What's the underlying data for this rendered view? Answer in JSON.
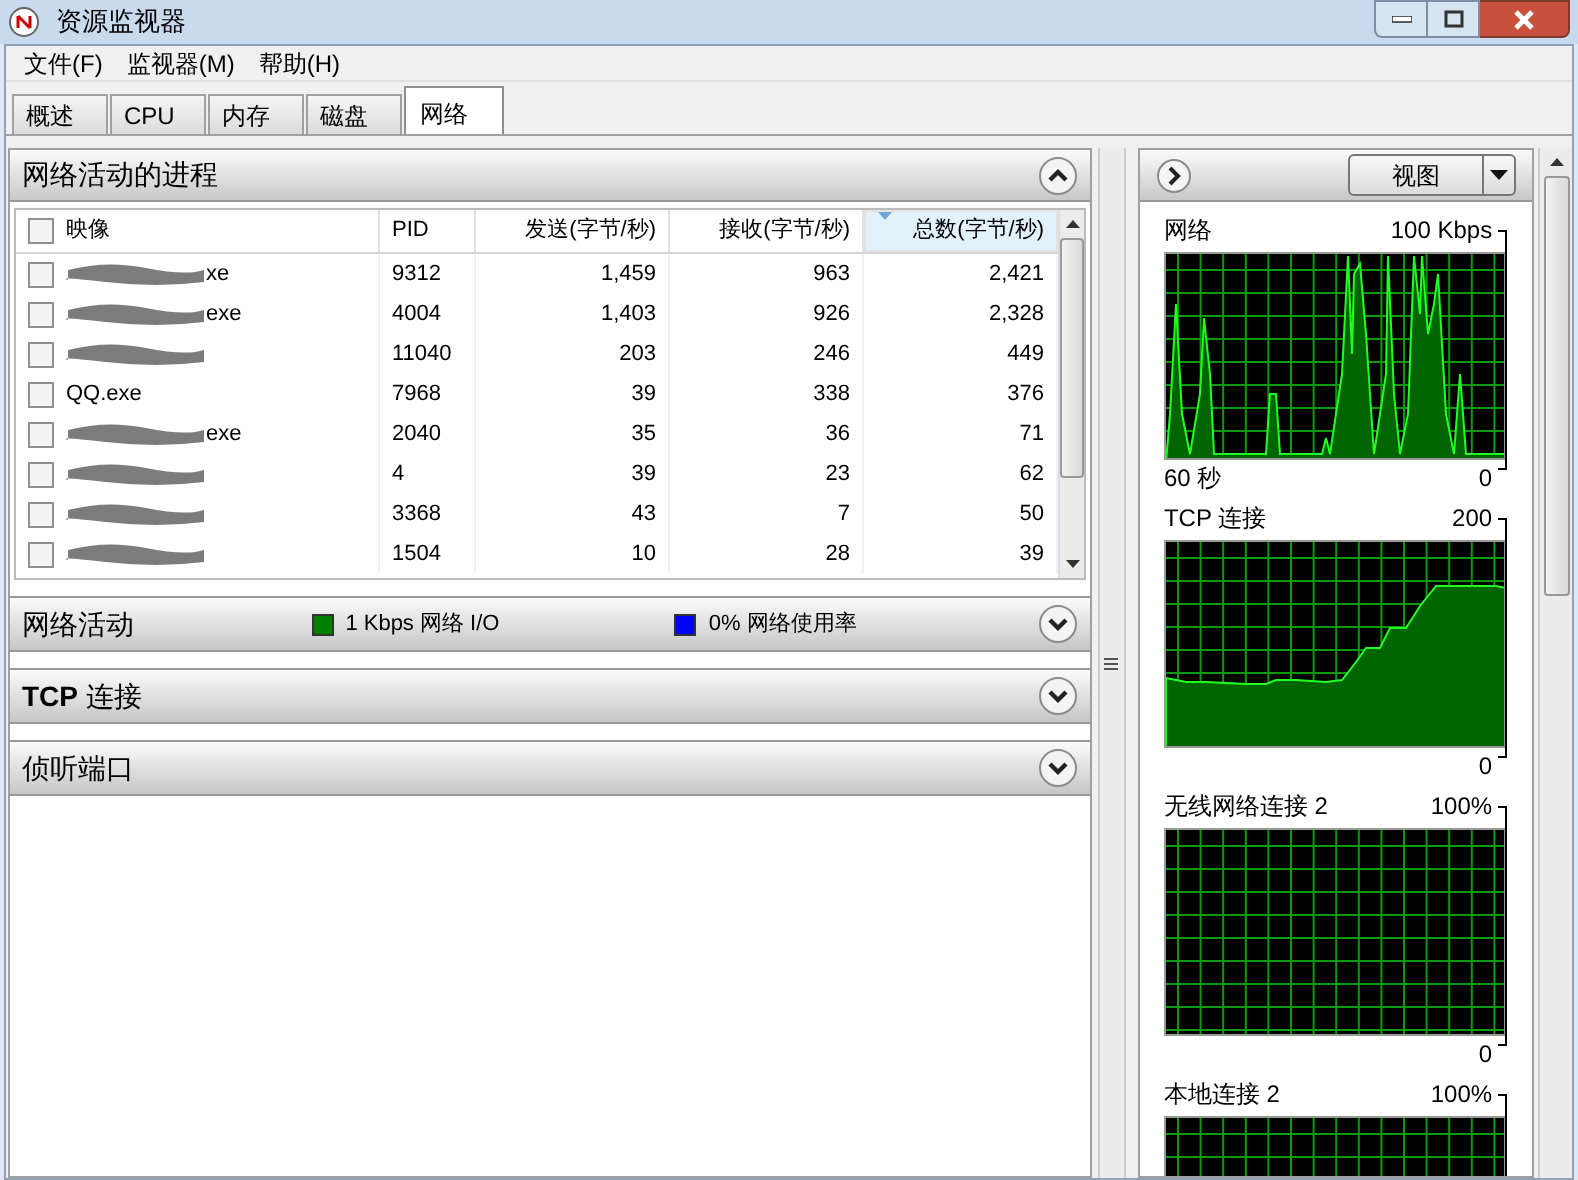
{
  "window": {
    "title": "资源监视器"
  },
  "menu": [
    "文件(F)",
    "监视器(M)",
    "帮助(H)"
  ],
  "tabs": [
    {
      "label": "概述",
      "selected": false
    },
    {
      "label": "CPU",
      "selected": false
    },
    {
      "label": "内存",
      "selected": false
    },
    {
      "label": "磁盘",
      "selected": false
    },
    {
      "label": "网络",
      "selected": true
    }
  ],
  "processes": {
    "title": "网络活动的进程",
    "expanded": true,
    "columns": [
      {
        "label": "映像",
        "sorted": false
      },
      {
        "label": "PID",
        "sorted": false
      },
      {
        "label": "发送(字节/秒)",
        "sorted": false
      },
      {
        "label": "接收(字节/秒)",
        "sorted": false
      },
      {
        "label": "总数(字节/秒)",
        "sorted": true
      }
    ],
    "rows": [
      {
        "image": "xe",
        "redacted": true,
        "checked": false,
        "pid": "9312",
        "send": "1,459",
        "receive": "963",
        "total": "2,421"
      },
      {
        "image": "exe",
        "redacted": true,
        "checked": false,
        "pid": "4004",
        "send": "1,403",
        "receive": "926",
        "total": "2,328"
      },
      {
        "redacted": true,
        "checked": false,
        "pid": "11040",
        "send": "203",
        "receive": "246",
        "total": "449"
      },
      {
        "image": "QQ.exe",
        "redacted": false,
        "checked": false,
        "pid": "7968",
        "send": "39",
        "receive": "338",
        "total": "376"
      },
      {
        "image": "exe",
        "redacted": true,
        "checked": false,
        "pid": "2040",
        "send": "35",
        "receive": "36",
        "total": "71"
      },
      {
        "redacted": true,
        "checked": false,
        "pid": "4",
        "send": "39",
        "receive": "23",
        "total": "62"
      },
      {
        "redacted": true,
        "checked": false,
        "pid": "3368",
        "send": "43",
        "receive": "7",
        "total": "50"
      },
      {
        "redacted": true,
        "checked": false,
        "pid": "1504",
        "send": "10",
        "receive": "28",
        "total": "39"
      }
    ]
  },
  "sections": [
    {
      "title": "网络活动",
      "expanded": false,
      "legend": [
        {
          "color": "#008000",
          "text": "1 Kbps 网络 I/O"
        },
        {
          "color": "#0000ff",
          "text": "0% 网络使用率"
        }
      ]
    },
    {
      "title": "**TCP** 连接",
      "expanded": false
    },
    {
      "title": "侦听端口",
      "expanded": false
    }
  ],
  "graphs_panel": {
    "view_button": "视图",
    "graphs": [
      {
        "kind": "network",
        "title": "网络",
        "max": "100 Kbps",
        "time": "60 秒",
        "min": "0"
      },
      {
        "kind": "tcp",
        "title": "TCP 连接",
        "max": "200",
        "min": "0"
      },
      {
        "kind": "empty",
        "title": "无线网络连接 2",
        "max": "100%",
        "min": "0"
      },
      {
        "kind": "empty",
        "title": "本地连接 2",
        "max": "100%"
      }
    ]
  }
}
